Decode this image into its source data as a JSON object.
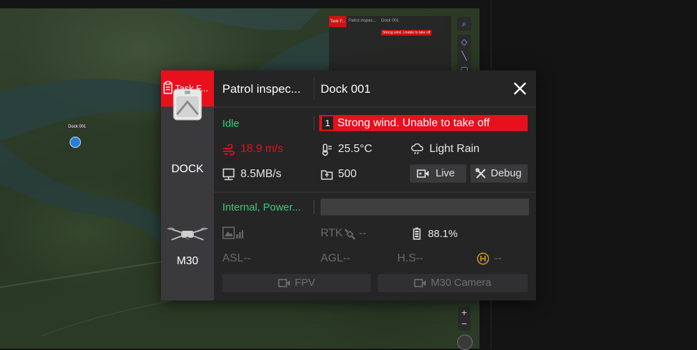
{
  "map": {
    "marker_label": "Dock 001"
  },
  "background_panel": {
    "tab": "Task F...",
    "task": "Patrol inspec...",
    "dock": "Dock 001",
    "alert": "Strong wind. Unable to take off"
  },
  "panel": {
    "task_tab_label": "Task F...",
    "task_title": "Patrol inspec...",
    "dock_title": "Dock 001",
    "dock": {
      "name": "DOCK",
      "status": "Idle",
      "alert_count": "1",
      "alert_message": "Strong wind. Unable to take off",
      "wind_speed": "18.9 m/s",
      "temperature": "25.5°C",
      "weather": "Light Rain",
      "network_rate": "8.5MB/s",
      "storage": "500",
      "live_label": "Live",
      "debug_label": "Debug"
    },
    "drone": {
      "name": "M30",
      "status": "Internal, Power...",
      "rtk_label": "RTK",
      "rtk_value": "--",
      "battery": "88.1%",
      "asl": "ASL--",
      "agl": "AGL--",
      "hs": "H.S--",
      "home_distance": "--",
      "fpv_label": "FPV",
      "camera_label": "M30 Camera"
    }
  },
  "colors": {
    "accent_red": "#e8101c",
    "status_green": "#2fd37a",
    "panel_bg": "#252526",
    "sidebar_bg": "#3a3a3c"
  },
  "icons": {
    "task": "clipboard-icon",
    "close": "close-icon",
    "wind": "wind-icon",
    "temperature": "thermometer-icon",
    "weather": "cloud-rain-icon",
    "network": "network-icon",
    "storage": "storage-icon",
    "live": "video-icon",
    "debug": "tools-icon",
    "image_signal": "image-signal-icon",
    "rtk": "satellite-icon",
    "battery": "battery-icon",
    "home": "home-point-icon"
  }
}
